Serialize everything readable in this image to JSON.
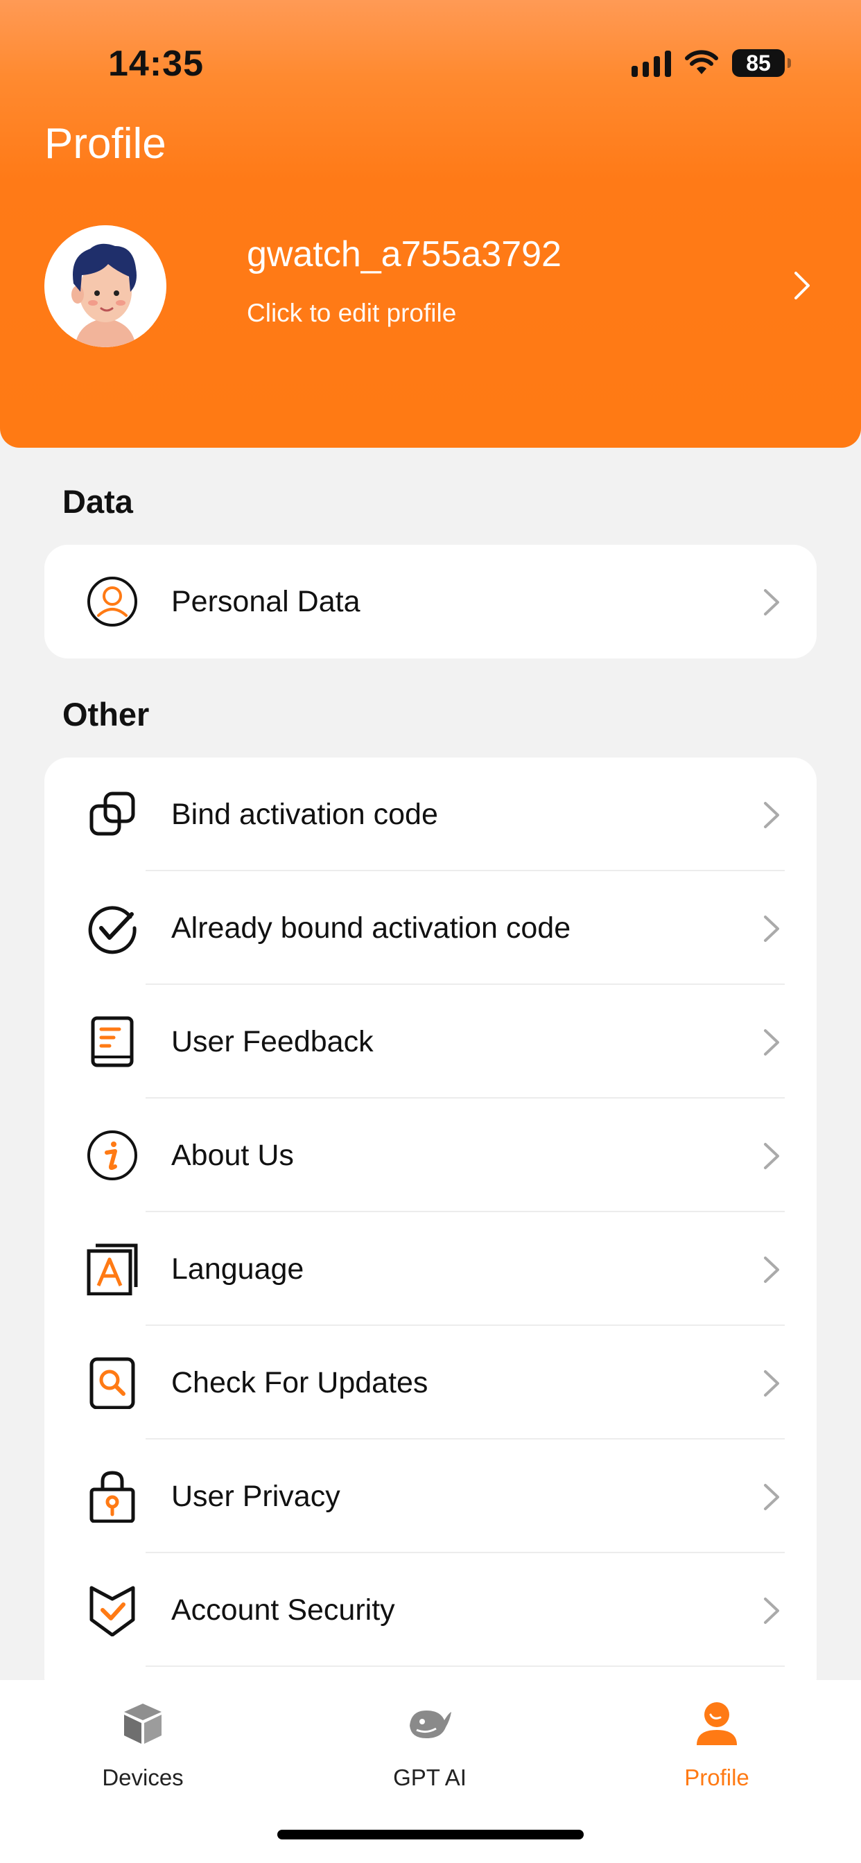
{
  "status_bar": {
    "time": "14:35",
    "battery": "85"
  },
  "header": {
    "title": "Profile",
    "username": "gwatch_a755a3792",
    "edit_hint": "Click to edit profile"
  },
  "sections": {
    "data": {
      "title": "Data",
      "items": [
        {
          "label": "Personal Data",
          "icon": "person-circle-icon"
        }
      ]
    },
    "other": {
      "title": "Other",
      "items": [
        {
          "label": "Bind activation code",
          "icon": "link-icon"
        },
        {
          "label": "Already bound activation code",
          "icon": "check-circle-icon"
        },
        {
          "label": "User Feedback",
          "icon": "feedback-document-icon"
        },
        {
          "label": "About Us",
          "icon": "info-icon"
        },
        {
          "label": "Language",
          "icon": "language-icon"
        },
        {
          "label": "Check For Updates",
          "icon": "search-update-icon"
        },
        {
          "label": "User Privacy",
          "icon": "lock-icon"
        },
        {
          "label": "Account Security",
          "icon": "shield-icon"
        }
      ]
    }
  },
  "tabbar": {
    "tabs": [
      {
        "label": "Devices",
        "icon": "box-icon",
        "active": false
      },
      {
        "label": "GPT AI",
        "icon": "whale-icon",
        "active": false
      },
      {
        "label": "Profile",
        "icon": "user-icon",
        "active": true
      }
    ]
  },
  "colors": {
    "accent": "#ff7a14",
    "background": "#f2f2f2",
    "card": "#ffffff"
  }
}
